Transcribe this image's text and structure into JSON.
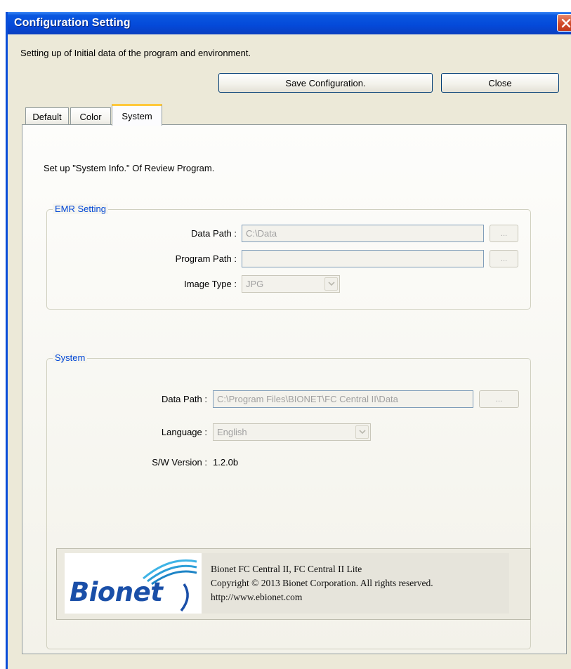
{
  "window": {
    "title": "Configuration Setting",
    "subtitle": "Setting up of Initial data of the program and environment."
  },
  "toolbar": {
    "save_label": "Save Configuration.",
    "close_label": "Close"
  },
  "tabs": [
    {
      "label": "Default",
      "active": false
    },
    {
      "label": "Color",
      "active": false
    },
    {
      "label": "System",
      "active": true
    }
  ],
  "panel": {
    "intro": "Set up \"System Info.\" Of Review Program."
  },
  "emr": {
    "title": "EMR Setting",
    "data_path_label": "Data Path :",
    "data_path_value": "C:\\Data",
    "program_path_label": "Program Path :",
    "program_path_value": "",
    "image_type_label": "Image Type :",
    "image_type_value": "JPG",
    "browse_label": "..."
  },
  "system": {
    "title": "System",
    "data_path_label": "Data Path :",
    "data_path_value": "C:\\Program Files\\BIONET\\FC Central II\\Data",
    "language_label": "Language :",
    "language_value": "English",
    "version_label": "S/W Version :",
    "version_value": "1.2.0b",
    "browse_label": "..."
  },
  "about": {
    "logo_text": "Bionet",
    "line1": "Bionet FC Central II, FC Central II Lite",
    "line2": "Copyright © 2013 Bionet Corporation. All rights reserved.",
    "line3": "http://www.ebionet.com"
  },
  "colors": {
    "titlebar": "#0449d9",
    "close_button": "#d14a2a",
    "group_title": "#0046d5",
    "logo": "#1a4fa8",
    "tab_highlight": "#ffc83c"
  }
}
